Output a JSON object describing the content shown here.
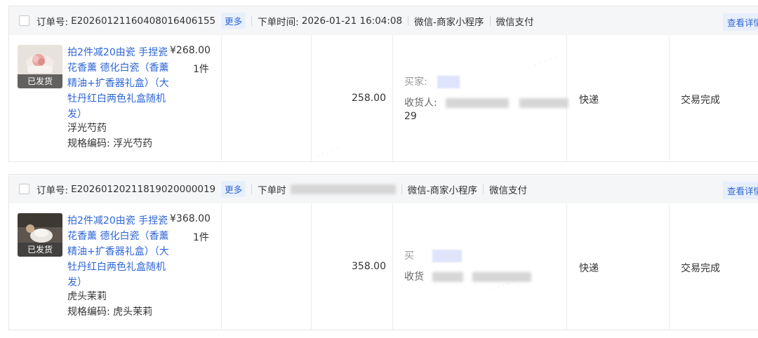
{
  "orders": [
    {
      "order_no_label": "订单号:",
      "order_no": "E20260121160408016406155",
      "more_label": "更多",
      "time_label": "下单时间:",
      "time_value": "2026-01-21 16:04:08",
      "channel": "微信-商家小程序",
      "payment": "微信支付",
      "detail_label": "查看详情",
      "product": {
        "title": "拍2件减20由瓷 手捏瓷花香薰 德化白瓷（香薰精油+扩香器礼盒）（大牡丹红白两色礼盒随机发）",
        "variant": "浮光芍药",
        "sku": "规格编码: 浮光芍药",
        "price": "¥268.00",
        "qty": "1件",
        "badge": "已发货"
      },
      "paid": "258.00",
      "buyer_label": "买家:",
      "receiver_label": "收货人:",
      "receiver_extra": "29",
      "shipping": "快递",
      "status": "交易完成"
    },
    {
      "order_no_label": "订单号:",
      "order_no": "E20260120211819020000019",
      "more_label": "更多",
      "time_label": "下单时",
      "time_value": "",
      "channel": "微信-商家小程序",
      "payment": "微信支付",
      "detail_label": "查看详情",
      "product": {
        "title": "拍2件减20由瓷 手捏瓷花香薰 德化白瓷（香薰精油+扩香器礼盒）（大牡丹红白两色礼盒随机发）",
        "variant": "虎头茉莉",
        "sku": "规格编码: 虎头茉莉",
        "price": "¥368.00",
        "qty": "1件",
        "badge": "已发货"
      },
      "paid": "358.00",
      "buyer_label": "买",
      "receiver_label": "收货",
      "receiver_extra": "",
      "shipping": "快递",
      "status": "交易完成"
    }
  ],
  "colors": {
    "link": "#2e66d6",
    "header_bg": "#f5f6f8",
    "border": "#e8e8e8"
  }
}
